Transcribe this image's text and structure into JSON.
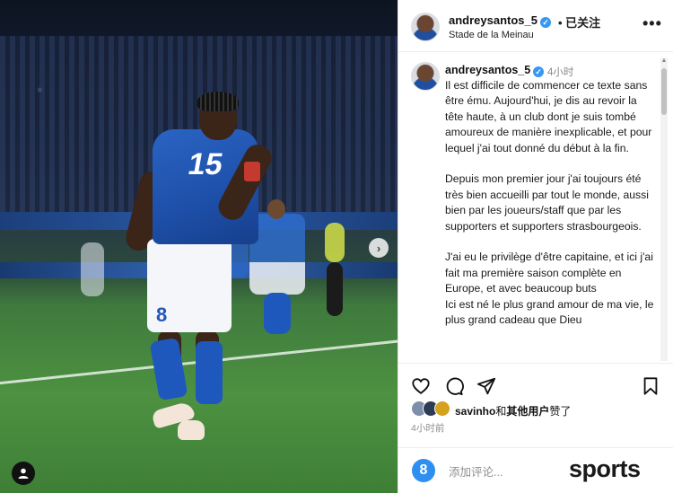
{
  "post": {
    "username": "andreysantos_5",
    "follow_status": "已关注",
    "location": "Stade de la Meinau",
    "more_label": "•••",
    "caption_time": "4小时",
    "caption": "Il est difficile de commencer ce texte sans être ému. Aujourd'hui, je dis au revoir la tête haute, à un club dont je suis tombé amoureux de manière inexplicable, et pour lequel j'ai tout donné du début à la fin.\n\nDepuis mon premier jour j'ai toujours été très bien accueilli par tout le monde, aussi bien par les joueurs/staff que par les supporters et supporters strasbourgeois.\n\nJ'ai eu le privilège d'être capitaine, et ici j'ai fait ma première saison complète en Europe, et avec beaucoup buts\nIci est né le plus grand amour de ma vie, le plus grand cadeau que Dieu",
    "likes": {
      "user": "savinho",
      "connector": "和",
      "others": "其他用户",
      "suffix": "赞了"
    },
    "post_time": "4小时前",
    "comment_placeholder": "添加评论..."
  },
  "photo": {
    "shirt_number_front": "15",
    "shorts_number": "8",
    "carousel_next": "›"
  },
  "watermark": "sports",
  "icons": {
    "verified": "verified-badge-icon",
    "like": "heart-icon",
    "comment": "comment-bubble-icon",
    "share": "paper-plane-icon",
    "save": "bookmark-icon",
    "tag": "user-tag-icon",
    "emoji": "emoji-icon"
  },
  "colors": {
    "verified_blue": "#3897f0",
    "club_blue": "#1e58bd",
    "text_secondary": "#8e8e8e"
  }
}
